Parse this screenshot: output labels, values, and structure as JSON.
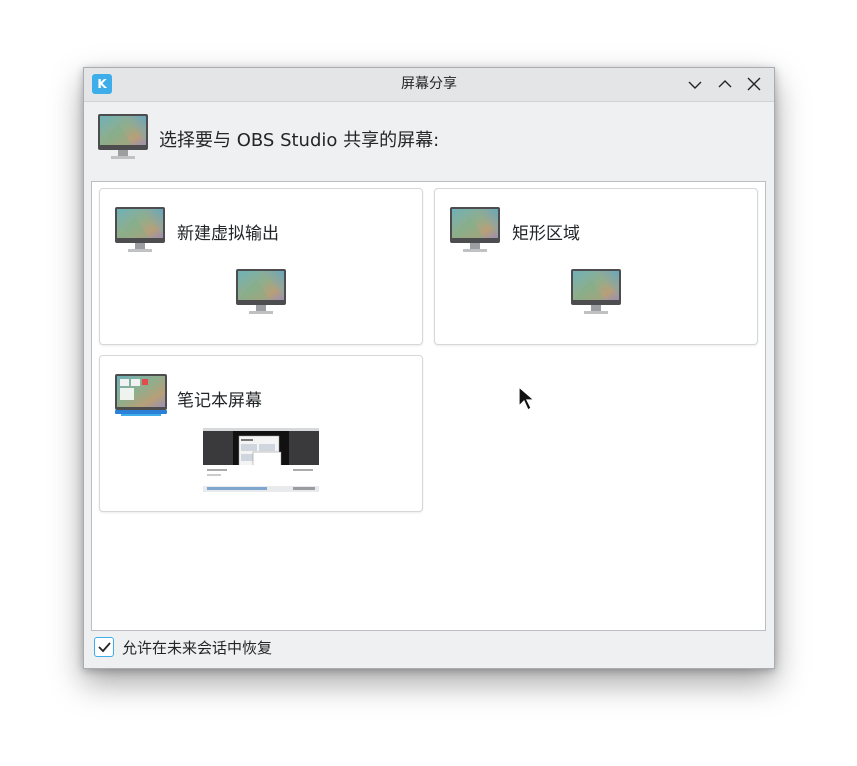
{
  "window": {
    "title": "屏幕分享",
    "app_icon": "kde-logo-icon",
    "controls": [
      "minimize-icon",
      "maximize-icon",
      "close-icon"
    ]
  },
  "header": {
    "prompt": "选择要与 OBS Studio 共享的屏幕:",
    "icon": "monitor-icon"
  },
  "cards": [
    {
      "label": "新建虚拟输出",
      "icon": "monitor-icon",
      "preview": "monitor-icon"
    },
    {
      "label": "矩形区域",
      "icon": "monitor-icon",
      "preview": "monitor-icon"
    },
    {
      "label": "笔记本屏幕",
      "icon": "laptop-screen-icon",
      "preview": "screen-thumbnail"
    }
  ],
  "footer": {
    "checkbox_label": "允许在未来会话中恢复",
    "checked": true
  },
  "colors": {
    "accent": "#3daee9",
    "window_bg": "#eff0f1",
    "text": "#232629"
  }
}
